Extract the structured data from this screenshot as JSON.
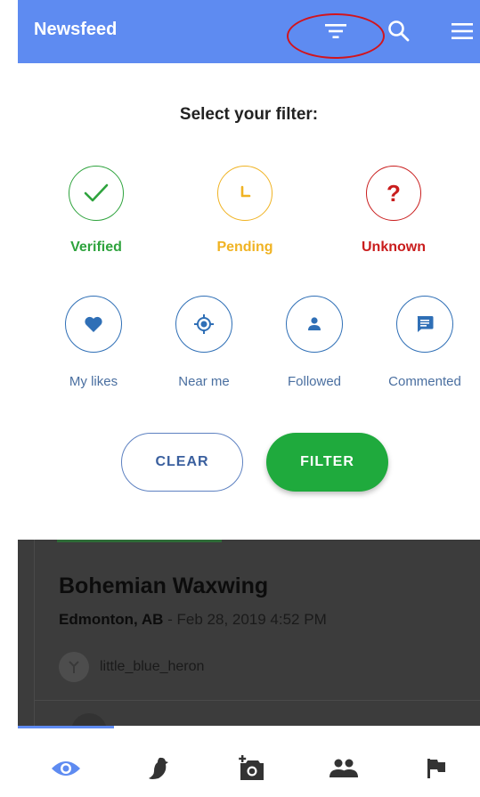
{
  "header": {
    "title": "Newsfeed",
    "icons": [
      "filter-icon",
      "search-icon",
      "menu-icon"
    ],
    "color": "#5e8bf1"
  },
  "filter_panel": {
    "heading": "Select your filter:",
    "statuses": [
      {
        "label": "Verified",
        "icon": "check-icon",
        "color": "#2ea33d"
      },
      {
        "label": "Pending",
        "icon": "clock-icon",
        "color": "#f0b323"
      },
      {
        "label": "Unknown",
        "icon": "question-icon",
        "color": "#c91d1d"
      }
    ],
    "options": [
      {
        "label": "My likes",
        "icon": "heart-icon"
      },
      {
        "label": "Near me",
        "icon": "location-icon"
      },
      {
        "label": "Followed",
        "icon": "person-icon"
      },
      {
        "label": "Commented",
        "icon": "comment-icon"
      }
    ],
    "clear_label": "CLEAR",
    "filter_label": "FILTER"
  },
  "feed": {
    "bird_name": "Bohemian Waxwing",
    "location": "Edmonton, AB",
    "separator": " - ",
    "datetime": "Feb 28, 2019 4:52 PM",
    "username": "little_blue_heron"
  },
  "bottom_nav": {
    "items": [
      "eye-icon",
      "bird-icon",
      "add-photo-icon",
      "people-icon",
      "flag-icon"
    ],
    "active_index": 0
  }
}
